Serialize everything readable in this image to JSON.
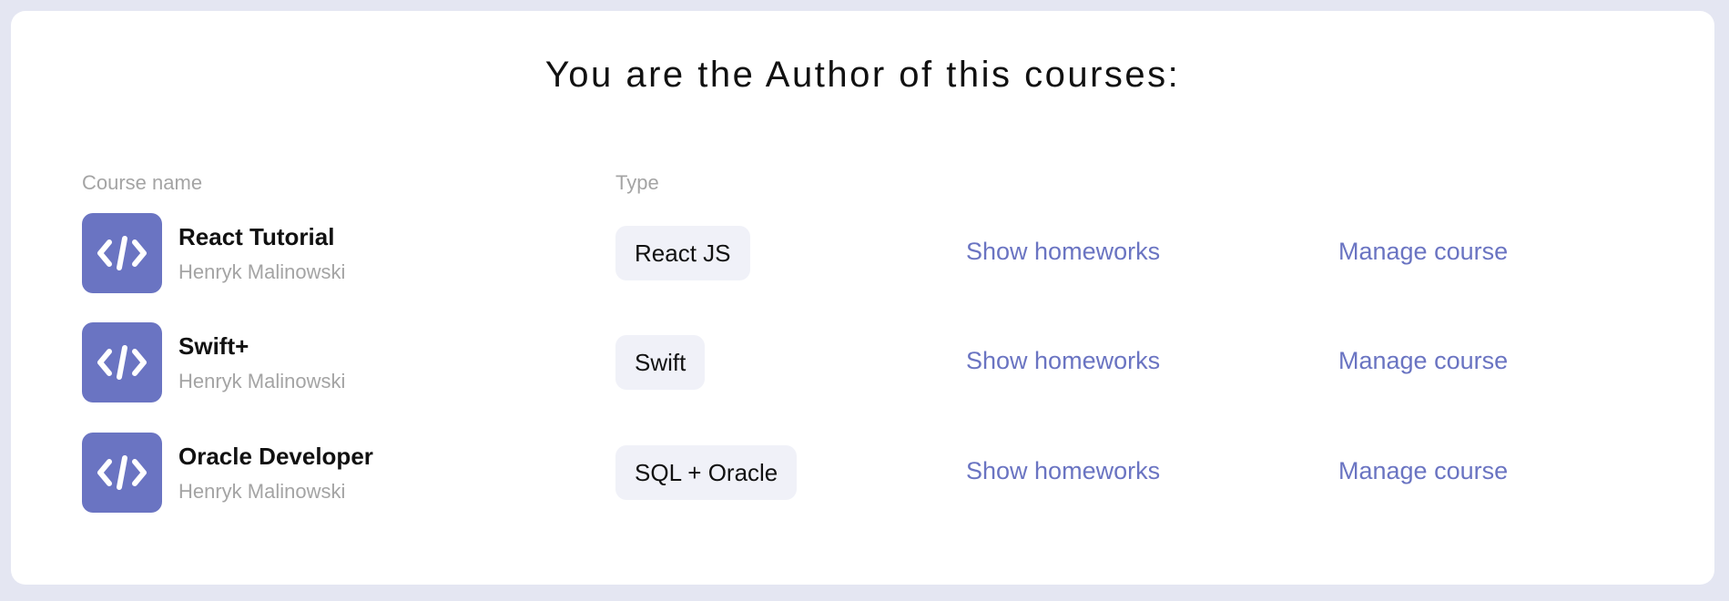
{
  "theme": {
    "accent": "#6a74c2",
    "page_background": "#e4e6f2",
    "card_background": "#ffffff",
    "pill_background": "#f0f1f8",
    "muted_text": "#a4a4a4"
  },
  "header": {
    "title": "You are the Author of this courses:"
  },
  "table": {
    "columns": {
      "course_name": "Course name",
      "type": "Type"
    },
    "rows": [
      {
        "icon": "code-icon",
        "title": "React Tutorial",
        "author": "Henryk Malinowski",
        "type": "React JS",
        "homeworks_label": "Show homeworks",
        "manage_label": "Manage course"
      },
      {
        "icon": "code-icon",
        "title": "Swift+",
        "author": "Henryk Malinowski",
        "type": "Swift",
        "homeworks_label": "Show homeworks",
        "manage_label": "Manage course"
      },
      {
        "icon": "code-icon",
        "title": "Oracle Developer",
        "author": "Henryk Malinowski",
        "type": "SQL + Oracle",
        "homeworks_label": "Show homeworks",
        "manage_label": "Manage course"
      }
    ]
  }
}
